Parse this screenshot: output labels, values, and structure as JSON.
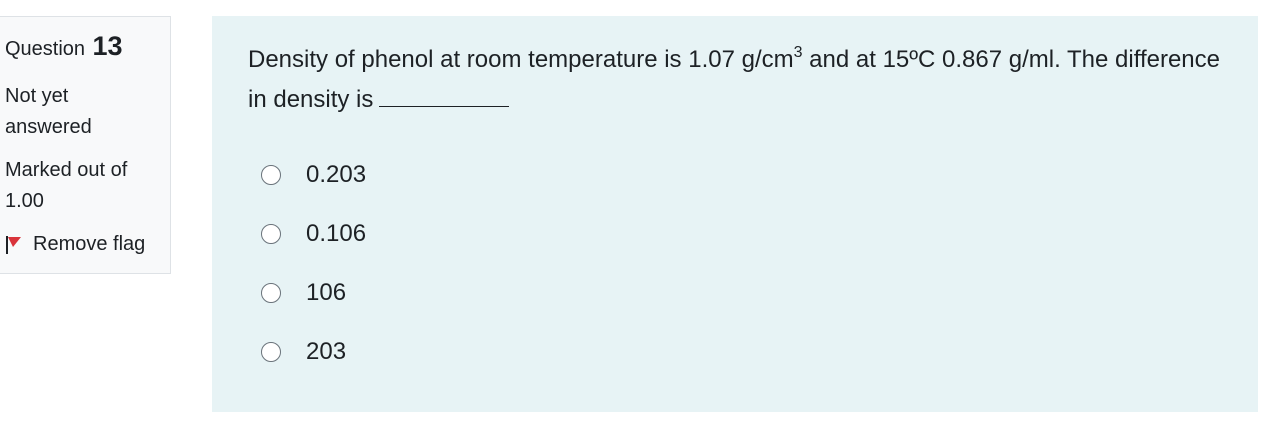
{
  "info": {
    "question_word": "Question",
    "question_number": "13",
    "state_line1": "Not yet",
    "state_line2": "answered",
    "grade_line1": "Marked out of",
    "grade_line2": "1.00",
    "flag_label": "Remove flag",
    "flag_color": "#d9343b"
  },
  "question": {
    "text_before_sup": "Density of phenol at room temperature is 1.07 g/cm",
    "sup": "3",
    "text_after_sup": " and at 15ºC 0.867 g/ml. The difference in density is",
    "options": [
      "0.203",
      "0.106",
      "106",
      "203"
    ],
    "selected": null
  },
  "colors": {
    "content_bg": "#e7f3f5",
    "info_bg": "#f8f9fa",
    "info_border": "#dee2e6",
    "text": "#1d2125"
  }
}
